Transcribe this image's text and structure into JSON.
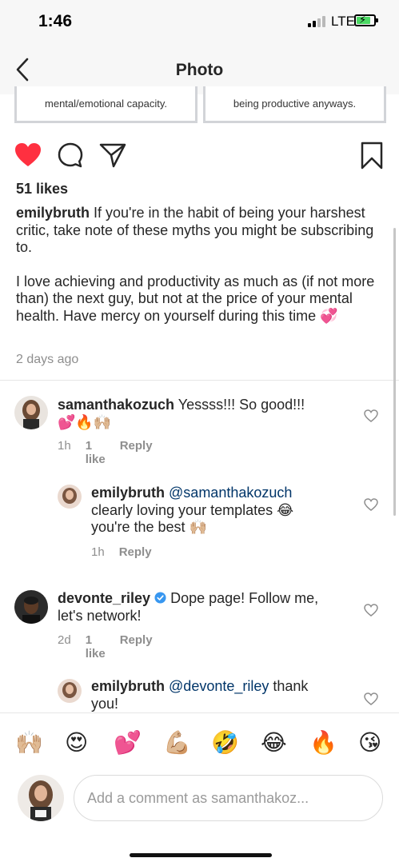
{
  "status_bar": {
    "time": "1:46",
    "network": "LTE"
  },
  "nav": {
    "title": "Photo"
  },
  "post_cards": {
    "left_text": "mental/emotional capacity.",
    "right_text": "being productive anyways."
  },
  "post": {
    "likes": "51 likes",
    "caption_user": "emilybruth",
    "caption_line1": " If you're in the habit of being your harshest critic, take note of these myths you might be subscribing to.",
    "caption_line2": "I love achieving and productivity as much as (if not more than) the next guy, but not at the price of your mental health. Have mercy on yourself during this time 💞",
    "time_ago": "2 days ago"
  },
  "comments": [
    {
      "user": "samanthakozuch",
      "text": " Yessss!!! So good!!!",
      "emoji": "💕🔥🙌🏼",
      "time": "1h",
      "likes": "1 like",
      "reply": "Reply"
    },
    {
      "user": "emilybruth",
      "mention": "@samanthakozuch",
      "text": "clearly loving your templates 😂",
      "text2": "you're the best 🙌🏼",
      "time": "1h",
      "reply": "Reply"
    },
    {
      "user": "devonte_riley",
      "verified": true,
      "text": " Dope page! Follow me,",
      "text2": "let's network!",
      "time": "2d",
      "likes": "1 like",
      "reply": "Reply"
    },
    {
      "user": "emilybruth",
      "mention": "@devonte_riley",
      "text": " thank",
      "text2": "you!"
    }
  ],
  "emoji_bar": [
    "🙌🏼",
    "😍",
    "💕",
    "💪🏼",
    "🤣",
    "😂",
    "🔥",
    "😘"
  ],
  "compose": {
    "placeholder": "Add a comment as samanthakoz..."
  },
  "colors": {
    "like_red": "#ff3040",
    "mention_blue": "#003569",
    "meta_gray": "#8e8e8e",
    "verified_blue": "#3897f0"
  }
}
